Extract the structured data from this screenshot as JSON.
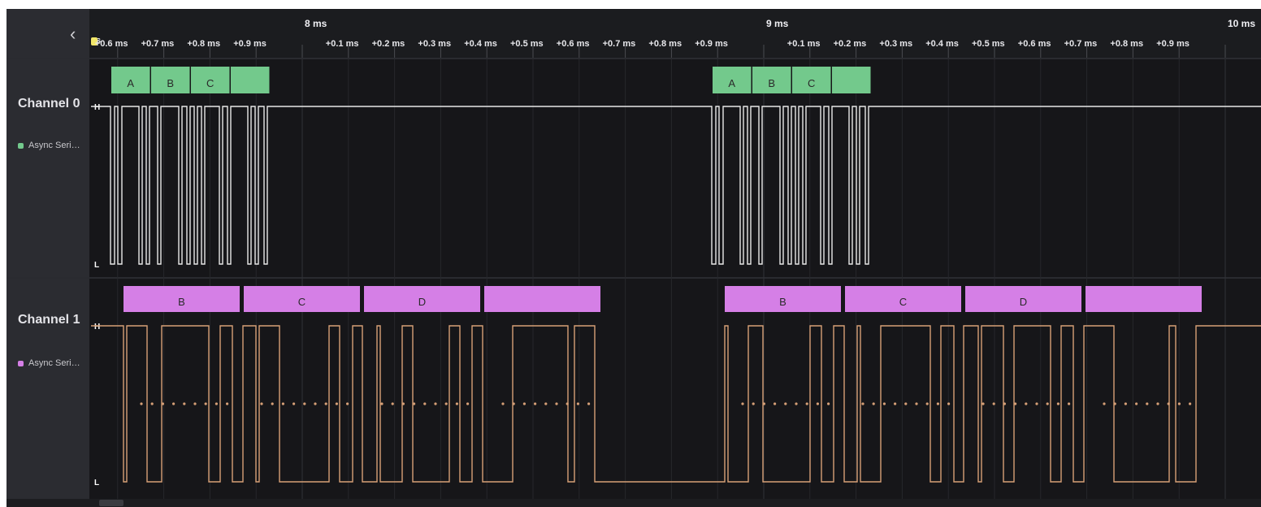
{
  "colors": {
    "channel0_frame": "#73c98c",
    "channel1_frame": "#d57fe6",
    "channel0_wave": "#e8e8e8",
    "channel1_wave": "#d7a077",
    "background": "#161619",
    "sidebar": "#2b2c31",
    "cursor_marker": "#f2e76a"
  },
  "sidebar": {
    "collapse_icon": "chevron-left-icon",
    "collapse_glyph": "‹",
    "channels": [
      {
        "name": "Channel 0",
        "analyzer": "Async Seri…",
        "swatch": "#73c98c"
      },
      {
        "name": "Channel 1",
        "analyzer": "Async Seri…",
        "swatch": "#d57fe6"
      }
    ]
  },
  "ruler": {
    "first_tick_fragment": "s",
    "major_labels": [
      "8 ms",
      "9 ms",
      "10 ms"
    ],
    "minor_labels_group1": [
      "+0.6 ms",
      "+0.7 ms",
      "+0.8 ms",
      "+0.9 ms"
    ],
    "minor_labels_group2": [
      "+0.1 ms",
      "+0.2 ms",
      "+0.3 ms",
      "+0.4 ms",
      "+0.5 ms",
      "+0.6 ms",
      "+0.7 ms",
      "+0.8 ms",
      "+0.9 ms"
    ],
    "minor_labels_group3": [
      "+0.1 ms",
      "+0.2 ms",
      "+0.3 ms",
      "+0.4 ms",
      "+0.5 ms",
      "+0.6 ms",
      "+0.7 ms",
      "+0.8 ms",
      "+0.9 ms"
    ]
  },
  "level_labels": {
    "high": "H",
    "low": "L"
  },
  "channel0": {
    "burst1_frames": [
      "A",
      "B",
      "C",
      ""
    ],
    "burst2_frames": [
      "A",
      "B",
      "C",
      ""
    ]
  },
  "channel1": {
    "burst1_frames": [
      "B",
      "C",
      "D",
      ""
    ],
    "burst2_frames": [
      "B",
      "C",
      "D",
      ""
    ]
  }
}
